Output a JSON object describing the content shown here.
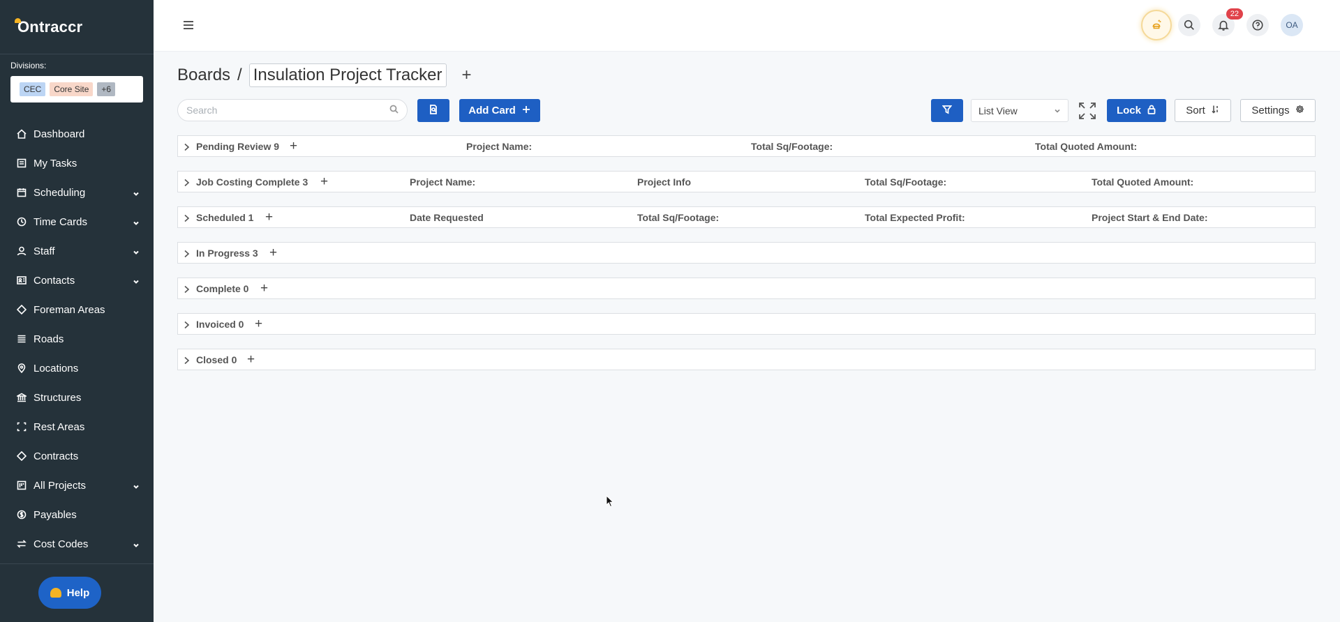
{
  "app": {
    "logo_text": "Ontraccr"
  },
  "divisions": {
    "label": "Divisions:",
    "chips": [
      "CEC",
      "Core Site",
      "+6"
    ]
  },
  "sidebar": {
    "items": [
      {
        "label": "Dashboard",
        "icon": "home-icon",
        "expandable": false
      },
      {
        "label": "My Tasks",
        "icon": "tasks-icon",
        "expandable": false
      },
      {
        "label": "Scheduling",
        "icon": "calendar-icon",
        "expandable": true
      },
      {
        "label": "Time Cards",
        "icon": "clock-icon",
        "expandable": true
      },
      {
        "label": "Staff",
        "icon": "user-icon",
        "expandable": true
      },
      {
        "label": "Contacts",
        "icon": "contacts-icon",
        "expandable": true
      },
      {
        "label": "Foreman Areas",
        "icon": "diamond-icon",
        "expandable": false
      },
      {
        "label": "Roads",
        "icon": "road-icon",
        "expandable": false
      },
      {
        "label": "Locations",
        "icon": "location-pin-icon",
        "expandable": false
      },
      {
        "label": "Structures",
        "icon": "bank-icon",
        "expandable": false
      },
      {
        "label": "Rest Areas",
        "icon": "rest-area-icon",
        "expandable": false
      },
      {
        "label": "Contracts",
        "icon": "diamond-icon",
        "expandable": false
      },
      {
        "label": "All Projects",
        "icon": "projects-icon",
        "expandable": true
      },
      {
        "label": "Payables",
        "icon": "dollar-circle-icon",
        "expandable": false
      },
      {
        "label": "Cost Codes",
        "icon": "swap-icon",
        "expandable": true
      }
    ],
    "help_label": "Help"
  },
  "topbar": {
    "notification_count": "22",
    "avatar_initials": "OA"
  },
  "breadcrumb": {
    "root": "Boards",
    "separator": "/",
    "board_title": "Insulation Project Tracker"
  },
  "toolbar": {
    "search_placeholder": "Search",
    "add_card_label": "Add Card",
    "view_select": "List View",
    "lock_label": "Lock",
    "sort_label": "Sort",
    "settings_label": "Settings"
  },
  "rows": [
    {
      "label": "Pending Review 9",
      "columns": [
        "Project Name:",
        "Total Sq/Footage:",
        "Total Quoted Amount:"
      ]
    },
    {
      "label": "Job Costing Complete 3",
      "columns": [
        "Project Name:",
        "Project Info",
        "Total Sq/Footage:",
        "Total Quoted Amount:"
      ]
    },
    {
      "label": "Scheduled 1",
      "columns": [
        "Date Requested",
        "Total Sq/Footage:",
        "Total Expected Profit:",
        "Project Start & End Date:"
      ]
    },
    {
      "label": "In Progress 3",
      "columns": []
    },
    {
      "label": "Complete 0",
      "columns": []
    },
    {
      "label": "Invoiced 0",
      "columns": []
    },
    {
      "label": "Closed 0",
      "columns": []
    }
  ],
  "colors": {
    "sidebar_bg": "#25323a",
    "primary_blue": "#1e5fc3",
    "badge_red": "#e0424a",
    "brand_yellow": "#f5b323"
  }
}
